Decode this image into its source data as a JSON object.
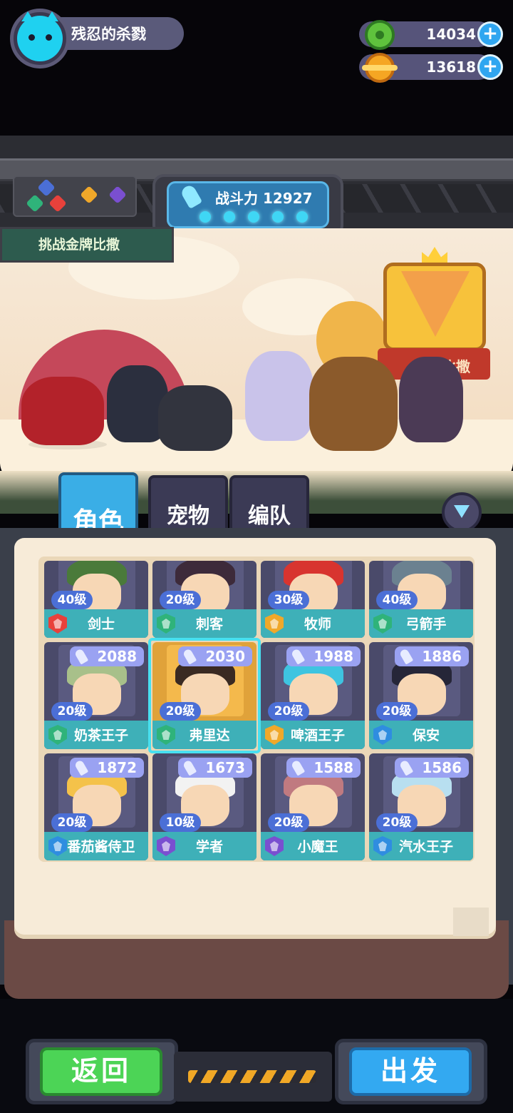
{
  "player": {
    "name": "残忍的杀戮"
  },
  "resources": [
    {
      "name": "green-gem",
      "value": "14034",
      "color": "#5fc23d"
    },
    {
      "name": "gold-coin",
      "value": "13618",
      "color": "#f5a623"
    }
  ],
  "team": {
    "power_label": "战斗力",
    "power_value": "12927",
    "slots": 5
  },
  "challenge": {
    "label": "挑战金牌比撒"
  },
  "event_banner": {
    "label": "金牌比撒"
  },
  "tabs": [
    {
      "label": "角色",
      "active": true
    },
    {
      "label": "宠物",
      "active": false
    },
    {
      "label": "编队",
      "active": false
    }
  ],
  "roster": [
    {
      "name": "剑士",
      "level": "40级",
      "power": "",
      "class_color": "#e8413b",
      "hair": "#4a7a3a"
    },
    {
      "name": "刺客",
      "level": "20级",
      "power": "",
      "class_color": "#2fb37a",
      "hair": "#3d2a3a"
    },
    {
      "name": "牧师",
      "level": "30级",
      "power": "",
      "class_color": "#f0a82a",
      "hair": "#d8342f"
    },
    {
      "name": "弓箭手",
      "level": "40级",
      "power": "",
      "class_color": "#2fb37a",
      "hair": "#6b8190"
    },
    {
      "name": "奶茶王子",
      "level": "20级",
      "power": "2088",
      "class_color": "#2fb37a",
      "hair": "#a8c08a"
    },
    {
      "name": "弗里达",
      "level": "20级",
      "power": "2030",
      "class_color": "#2fb37a",
      "hair": "#3a2a22",
      "selected": true
    },
    {
      "name": "啤酒王子",
      "level": "20级",
      "power": "1988",
      "class_color": "#f0a82a",
      "hair": "#3ec4e0"
    },
    {
      "name": "保安",
      "level": "20级",
      "power": "1886",
      "class_color": "#2f8de0",
      "hair": "#262638"
    },
    {
      "name": "番茄酱侍卫",
      "level": "20级",
      "power": "1872",
      "class_color": "#2f8de0",
      "hair": "#f4c24a"
    },
    {
      "name": "学者",
      "level": "10级",
      "power": "1673",
      "class_color": "#7a4fd0",
      "hair": "#f2f2f2"
    },
    {
      "name": "小魔王",
      "level": "20级",
      "power": "1588",
      "class_color": "#7a4fd0",
      "hair": "#c07a80"
    },
    {
      "name": "汽水王子",
      "level": "20级",
      "power": "1586",
      "class_color": "#2f8de0",
      "hair": "#b8dff0"
    }
  ],
  "buttons": {
    "back": "返回",
    "go": "出发"
  }
}
